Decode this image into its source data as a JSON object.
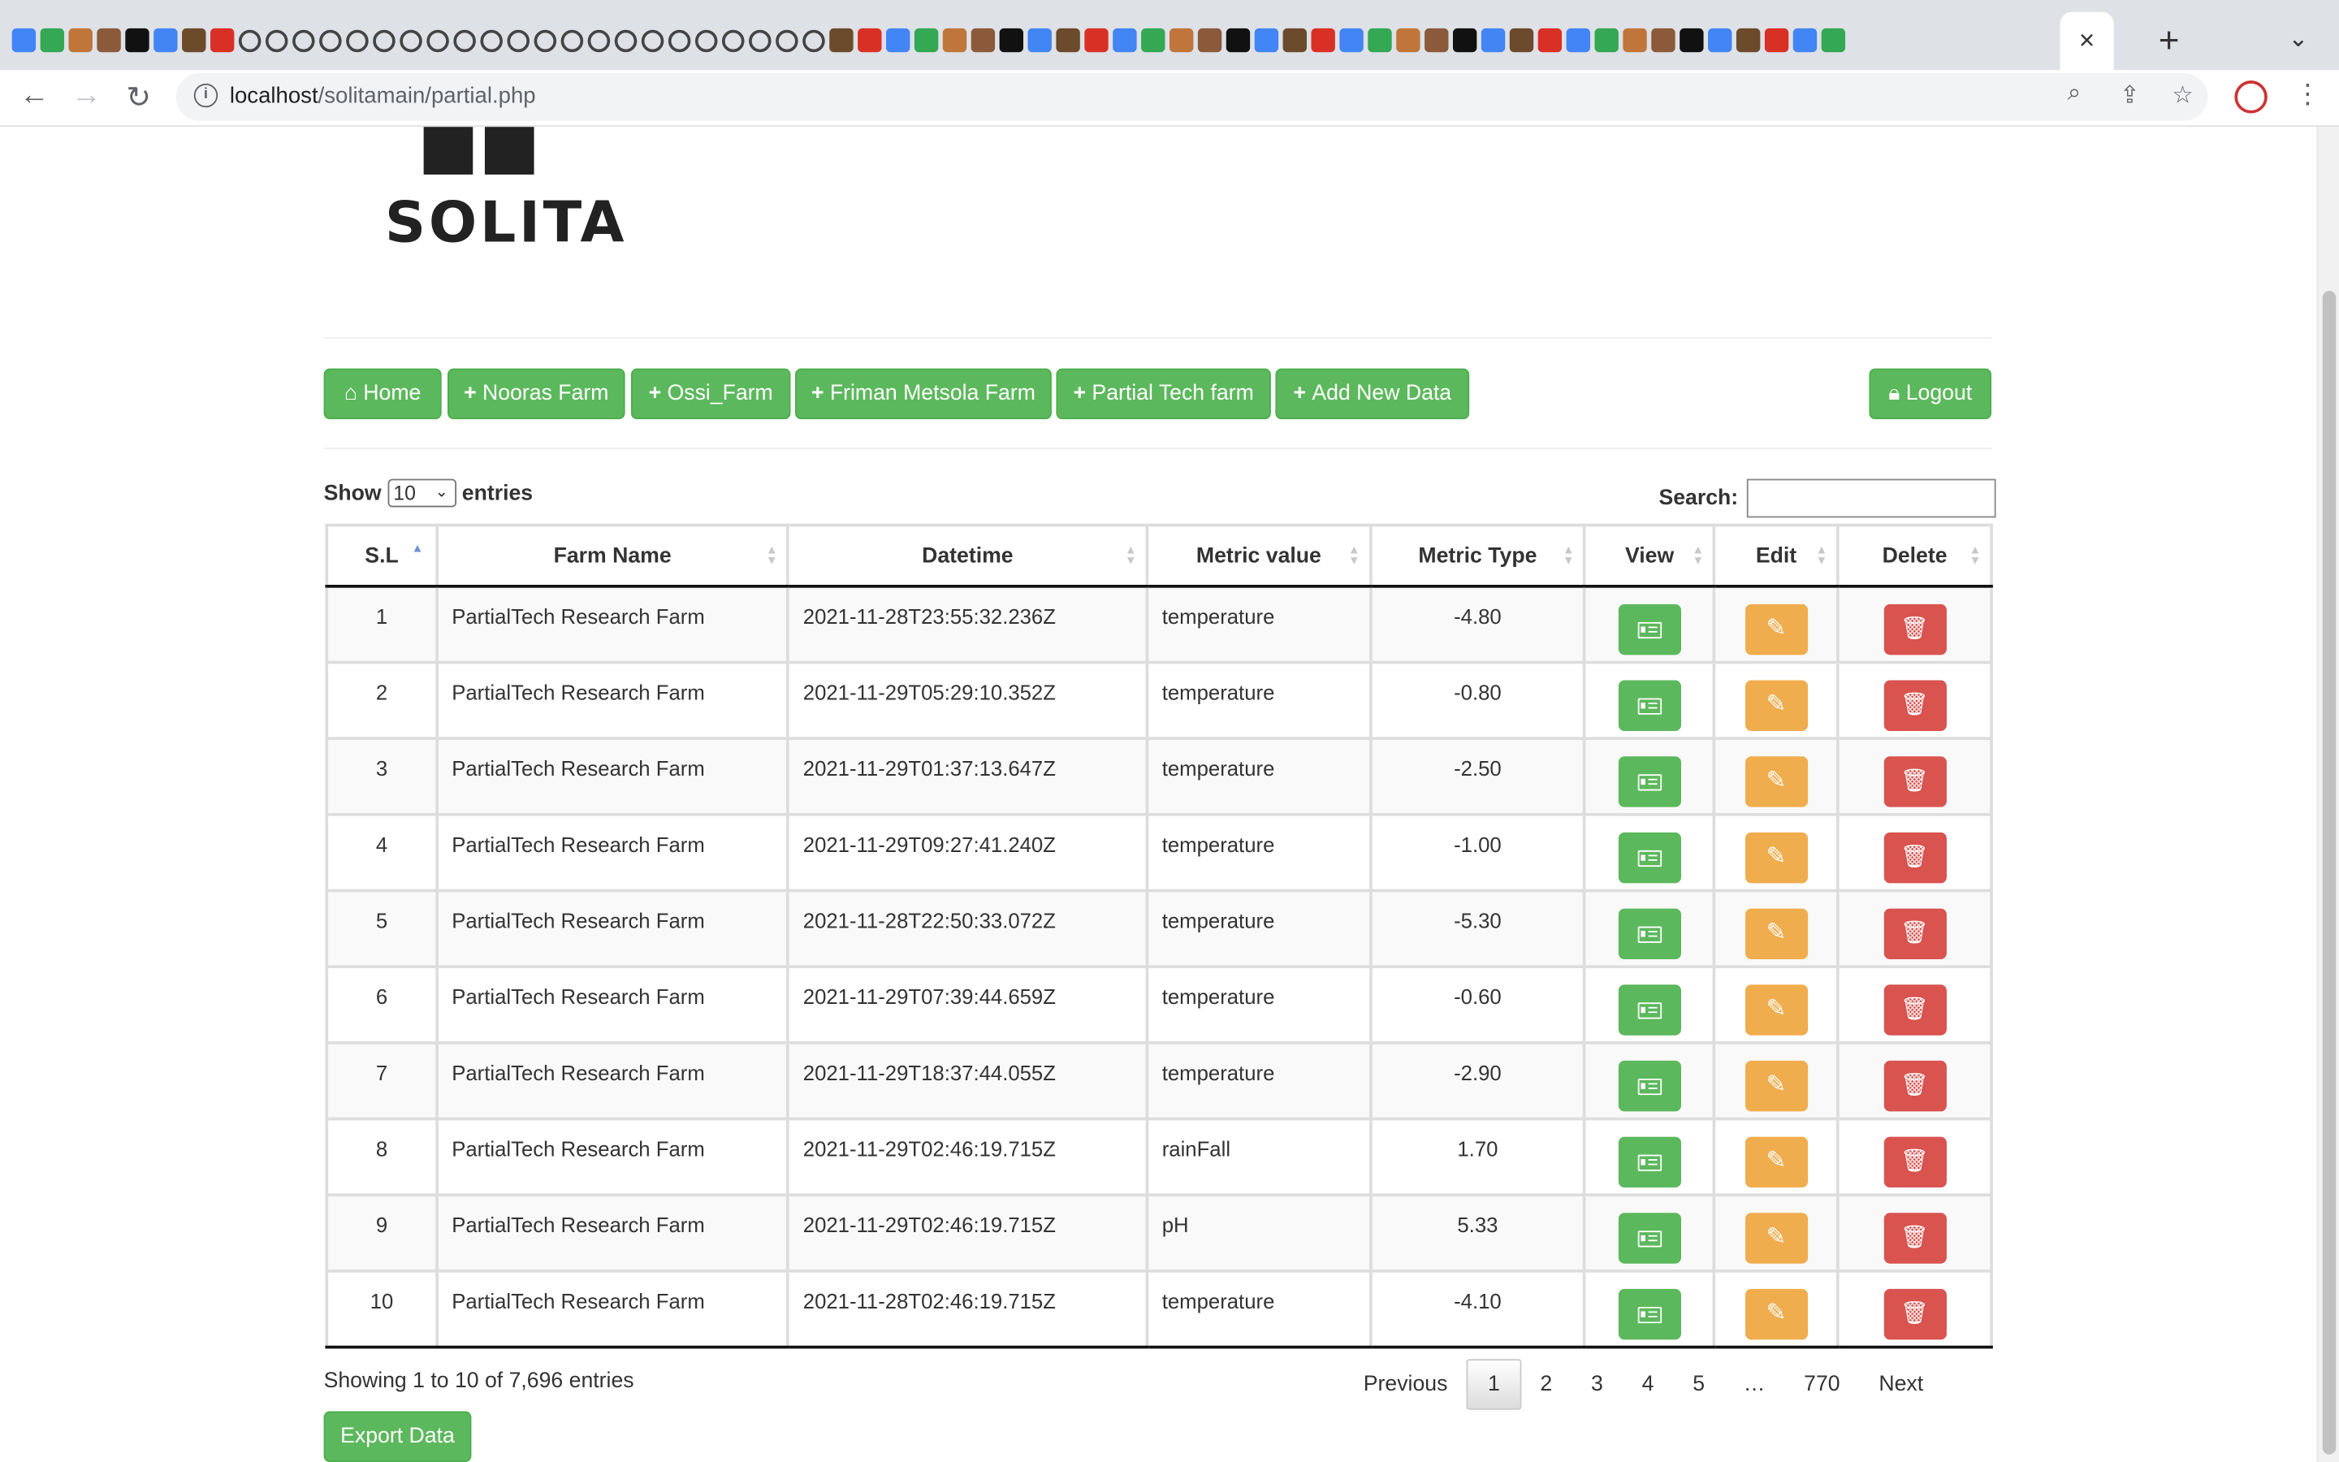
{
  "browser": {
    "url_host": "localhost",
    "url_path": "/solitamain/partial.php",
    "tab_close_glyph": "×",
    "new_tab_glyph": "+",
    "favicon_colors": [
      "#4285f4",
      "#34a853",
      "#c0763a",
      "#8a5a3a",
      "#111111",
      "#4285f4",
      "#6b4b2b",
      "#d93025"
    ]
  },
  "header": {
    "logo_text": "SOLITA"
  },
  "nav": {
    "home": "Home",
    "nooras": "Nooras Farm",
    "ossi": "Ossi_Farm",
    "friman": "Friman Metsola Farm",
    "partial": "Partial Tech farm",
    "add_new": "Add New Data",
    "logout": "Logout"
  },
  "controls": {
    "show_label": "Show",
    "entries_label": "entries",
    "page_length": "10",
    "search_label": "Search:",
    "search_value": ""
  },
  "table": {
    "columns": [
      "S.L",
      "Farm Name",
      "Datetime",
      "Metric value",
      "Metric Type",
      "View",
      "Edit",
      "Delete"
    ],
    "rows": [
      {
        "sl": "1",
        "farm": "PartialTech Research Farm",
        "datetime": "2021-11-28T23:55:32.236Z",
        "metric_value": "temperature",
        "metric_type": "-4.80"
      },
      {
        "sl": "2",
        "farm": "PartialTech Research Farm",
        "datetime": "2021-11-29T05:29:10.352Z",
        "metric_value": "temperature",
        "metric_type": "-0.80"
      },
      {
        "sl": "3",
        "farm": "PartialTech Research Farm",
        "datetime": "2021-11-29T01:37:13.647Z",
        "metric_value": "temperature",
        "metric_type": "-2.50"
      },
      {
        "sl": "4",
        "farm": "PartialTech Research Farm",
        "datetime": "2021-11-29T09:27:41.240Z",
        "metric_value": "temperature",
        "metric_type": "-1.00"
      },
      {
        "sl": "5",
        "farm": "PartialTech Research Farm",
        "datetime": "2021-11-28T22:50:33.072Z",
        "metric_value": "temperature",
        "metric_type": "-5.30"
      },
      {
        "sl": "6",
        "farm": "PartialTech Research Farm",
        "datetime": "2021-11-29T07:39:44.659Z",
        "metric_value": "temperature",
        "metric_type": "-0.60"
      },
      {
        "sl": "7",
        "farm": "PartialTech Research Farm",
        "datetime": "2021-11-29T18:37:44.055Z",
        "metric_value": "temperature",
        "metric_type": "-2.90"
      },
      {
        "sl": "8",
        "farm": "PartialTech Research Farm",
        "datetime": "2021-11-29T02:46:19.715Z",
        "metric_value": "rainFall",
        "metric_type": "1.70"
      },
      {
        "sl": "9",
        "farm": "PartialTech Research Farm",
        "datetime": "2021-11-29T02:46:19.715Z",
        "metric_value": "pH",
        "metric_type": "5.33"
      },
      {
        "sl": "10",
        "farm": "PartialTech Research Farm",
        "datetime": "2021-11-28T02:46:19.715Z",
        "metric_value": "temperature",
        "metric_type": "-4.10"
      }
    ]
  },
  "footer": {
    "info": "Showing 1 to 10 of 7,696 entries",
    "previous": "Previous",
    "pages": [
      "1",
      "2",
      "3",
      "4",
      "5",
      "…",
      "770"
    ],
    "current_page": "1",
    "next": "Next",
    "export": "Export Data"
  },
  "colors": {
    "success": "#5cb85c",
    "warning": "#f0ad4e",
    "danger": "#d9534f"
  }
}
